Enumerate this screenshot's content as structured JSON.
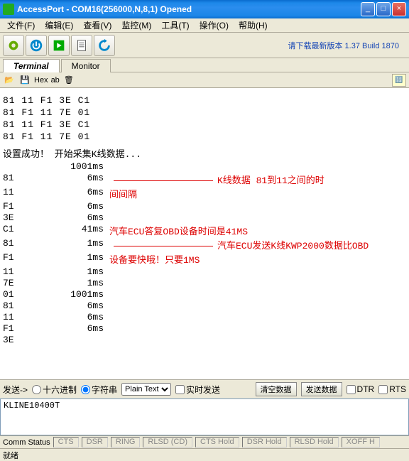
{
  "window": {
    "title": "AccessPort - COM16(256000,N,8,1) Opened"
  },
  "menu": [
    "文件(F)",
    "编辑(E)",
    "查看(V)",
    "监控(M)",
    "工具(T)",
    "操作(O)",
    "帮助(H)"
  ],
  "version_text": "请下载最新版本 1.37 Build 1870",
  "tabs": {
    "terminal": "Terminal",
    "monitor": "Monitor"
  },
  "subtool": {
    "hex": "Hex",
    "ab": "ab"
  },
  "hexlines": [
    "81 11 F1 3E C1",
    "81 F1 11 7E 01",
    "81 11 F1 3E C1",
    "81 F1 11 7E 01"
  ],
  "status_line": "设置成功！ 开始采集K线数据...",
  "timing_header": "1001ms",
  "rows": [
    {
      "b": "81",
      "t": "6ms",
      "note": "K线数据 81到11之间的时",
      "line": true
    },
    {
      "b": "11",
      "t": "6ms",
      "note": "间间隔"
    },
    {
      "b": "F1",
      "t": "6ms",
      "note": ""
    },
    {
      "b": "3E",
      "t": "6ms",
      "note": ""
    },
    {
      "b": "C1",
      "t": "41ms",
      "note": "汽车ECU答复OBD设备时间是41MS"
    },
    {
      "b": "81",
      "t": "1ms",
      "note": "汽车ECU发送K线KWP2000数据比OBD",
      "line": true
    },
    {
      "b": "F1",
      "t": "1ms",
      "note": "设备要快哦！只要1MS"
    },
    {
      "b": "11",
      "t": "1ms",
      "note": ""
    },
    {
      "b": "7E",
      "t": "1ms",
      "note": ""
    },
    {
      "b": "01",
      "t": "1001ms",
      "note": ""
    },
    {
      "b": "81",
      "t": "6ms",
      "note": ""
    },
    {
      "b": "11",
      "t": "6ms",
      "note": ""
    },
    {
      "b": "F1",
      "t": "6ms",
      "note": ""
    },
    {
      "b": "3E",
      "t": "",
      "note": ""
    }
  ],
  "send": {
    "label": "发送->",
    "mode_hex": "十六进制",
    "mode_str": "字符串",
    "plain": "Plain Text",
    "realtime": "实时发送",
    "clear": "清空数据",
    "send_btn": "发送数据",
    "dtr": "DTR",
    "rts": "RTS"
  },
  "input_value": "KLINE10400T",
  "comm_status": {
    "label": "Comm Status",
    "cts": "CTS",
    "dsr": "DSR",
    "ring": "RING",
    "rlsd": "RLSD (CD)",
    "cts_hold": "CTS Hold",
    "dsr_hold": "DSR Hold",
    "rlsd_hold": "RLSD Hold",
    "xoff": "XOFF H"
  },
  "status2": "就绪"
}
